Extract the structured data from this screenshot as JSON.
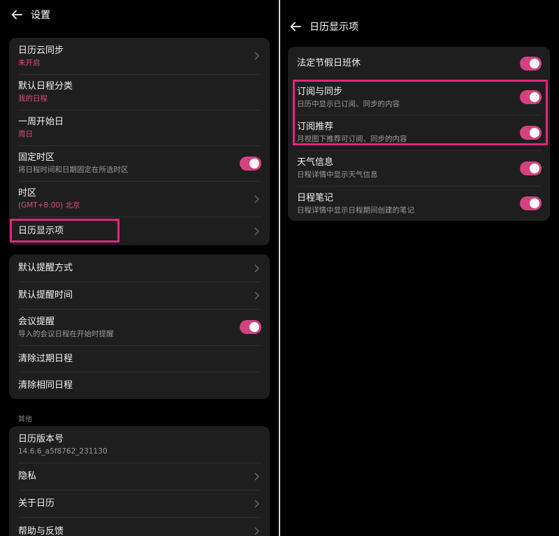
{
  "left": {
    "header": {
      "title": "设置"
    },
    "group1": [
      {
        "title": "日历云同步",
        "sub": "未开启"
      },
      {
        "title": "默认日程分类",
        "sub": "我的日程"
      },
      {
        "title": "一周开始日",
        "sub": "周日"
      },
      {
        "title": "固定时区",
        "sub": "将日程时间和日期固定在所选时区",
        "toggle": true
      },
      {
        "title": "时区",
        "sub": "(GMT+8:00) 北京"
      },
      {
        "title": "日历显示项"
      }
    ],
    "group2": [
      {
        "title": "默认提醒方式"
      },
      {
        "title": "默认提醒时间"
      },
      {
        "title": "会议提醒",
        "sub": "导入的会议日程在开始时提醒",
        "toggle": true
      },
      {
        "title": "清除过期日程"
      },
      {
        "title": "清除相同日程"
      }
    ],
    "other_label": "其他",
    "group3": [
      {
        "title": "日历版本号",
        "sub": "14.6.6_a5f8762_231130"
      },
      {
        "title": "隐私"
      },
      {
        "title": "关于日历"
      },
      {
        "title": "帮助与反馈"
      }
    ]
  },
  "right": {
    "header": {
      "title": "日历显示项"
    },
    "items": [
      {
        "title": "法定节假日班休",
        "toggle": true
      },
      {
        "title": "订阅与同步",
        "sub": "日历中显示已订阅、同步的内容",
        "toggle": true
      },
      {
        "title": "订阅推荐",
        "sub": "月视图下推荐可订阅、同步的内容",
        "toggle": true
      },
      {
        "title": "天气信息",
        "sub": "日程详情中显示天气信息",
        "toggle": true
      },
      {
        "title": "日程笔记",
        "sub": "日程详情中显示日程期间创建的笔记",
        "toggle": true
      }
    ]
  },
  "colors": {
    "accent": "#d2437d",
    "highlight": "#e0267a",
    "card": "#1e1e1e",
    "background": "#000000"
  }
}
